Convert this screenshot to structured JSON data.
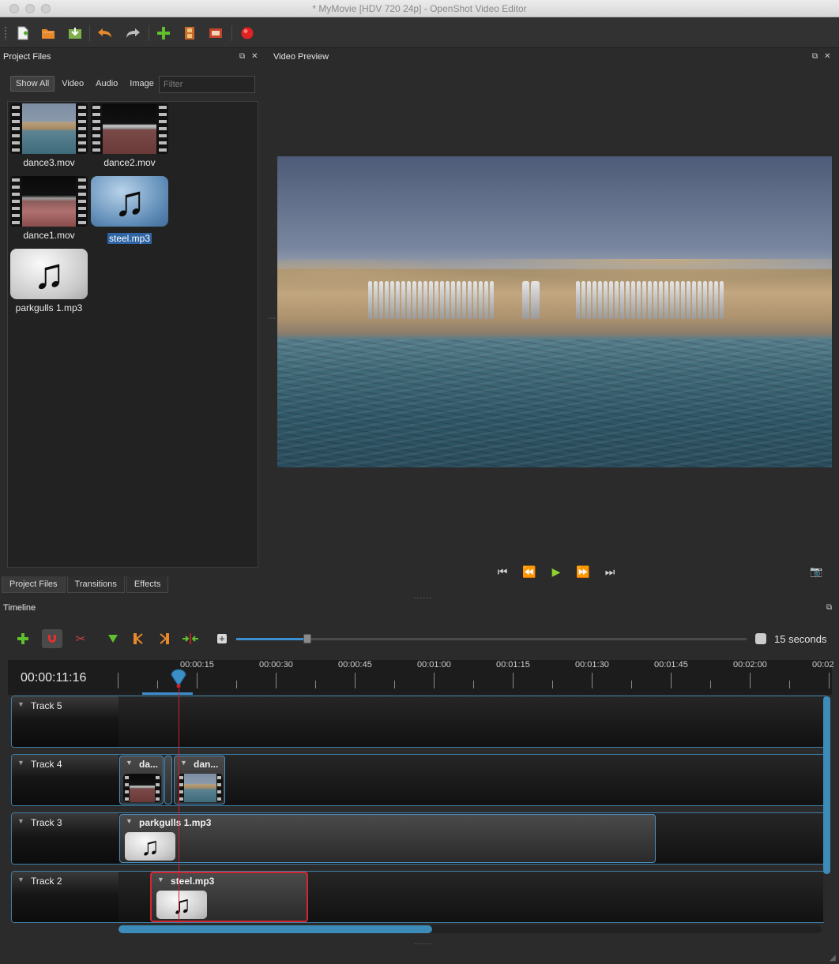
{
  "window": {
    "title": "* MyMovie [HDV 720 24p] - OpenShot Video Editor"
  },
  "toolbar": {
    "icons": [
      "new-project-icon",
      "open-project-icon",
      "save-project-icon",
      "undo-icon",
      "redo-icon",
      "import-files-icon",
      "choose-profile-icon",
      "fullscreen-icon",
      "export-video-icon"
    ]
  },
  "project_files": {
    "title": "Project Files",
    "filters": [
      "Show All",
      "Video",
      "Audio",
      "Image"
    ],
    "filter_placeholder": "Filter",
    "items": [
      {
        "name": "dance3.mov",
        "type": "video"
      },
      {
        "name": "dance2.mov",
        "type": "video"
      },
      {
        "name": "dance1.mov",
        "type": "video"
      },
      {
        "name": "steel.mp3",
        "type": "audio",
        "selected": true
      },
      {
        "name": "parkgulls 1.mp3",
        "type": "audio"
      }
    ],
    "tabs": [
      "Project Files",
      "Transitions",
      "Effects"
    ]
  },
  "video_preview": {
    "title": "Video Preview",
    "controls": [
      "jump-start-icon",
      "rewind-icon",
      "play-icon",
      "fast-forward-icon",
      "jump-end-icon"
    ]
  },
  "timeline": {
    "title": "Timeline",
    "timecode": "00:00:11:16",
    "zoom_label": "15 seconds",
    "zoom_level": 0.14,
    "ticks": [
      "00:00:15",
      "00:00:30",
      "00:00:45",
      "00:01:00",
      "00:01:15",
      "00:01:30",
      "00:01:45",
      "00:02:00",
      "00:02"
    ],
    "tracks": [
      {
        "name": "Track 5",
        "clips": []
      },
      {
        "name": "Track 4",
        "clips": [
          {
            "title": "da..."
          },
          {
            "title": "dan..."
          }
        ]
      },
      {
        "name": "Track 3",
        "clips": [
          {
            "title": "parkgulls 1.mp3"
          }
        ]
      },
      {
        "name": "Track 2",
        "clips": [
          {
            "title": "steel.mp3",
            "selected": true
          }
        ]
      }
    ]
  },
  "colors": {
    "accent": "#3e8fd0",
    "playhead": "#d0202a",
    "selection": "#2f64a3"
  }
}
